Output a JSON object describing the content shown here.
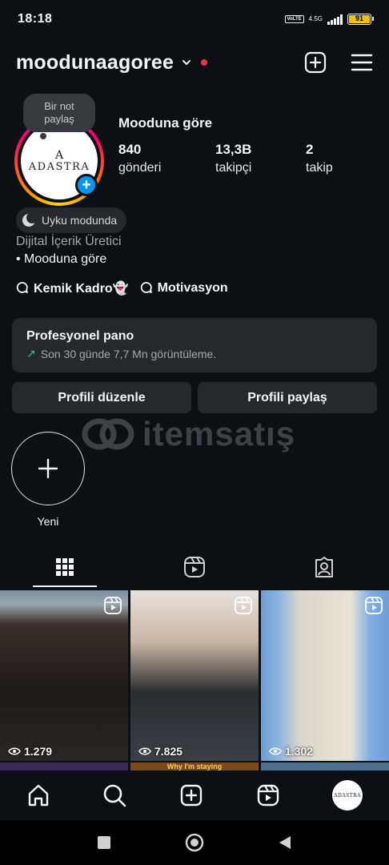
{
  "status_bar": {
    "time": "18:18",
    "volte": "VoLTE",
    "network": "4.5G",
    "battery": "91"
  },
  "header": {
    "username": "moodunaagoree"
  },
  "note": {
    "text": "Bir not paylaş"
  },
  "avatar": {
    "brand_letter": "A",
    "brand_name": "ADASTRA",
    "nav_brand": "ADASTRA"
  },
  "profile": {
    "display_name": "Mooduna göre",
    "stats": [
      {
        "value": "840",
        "label": "gönderi"
      },
      {
        "value": "13,3B",
        "label": "takipçi"
      },
      {
        "value": "2",
        "label": "takip"
      }
    ],
    "sleep_status": "Uyku modunda",
    "category": "Dijital İçerik Üretici",
    "bio": "• Mooduna göre",
    "channels": [
      "Kemik Kadro👻",
      "Motivasyon"
    ]
  },
  "pro_dashboard": {
    "title": "Profesyonel pano",
    "subtitle": "Son 30 günde 7,7 Mn görüntüleme."
  },
  "buttons": {
    "edit": "Profili düzenle",
    "share": "Profili paylaş"
  },
  "watermark": "itemsatış",
  "new_story": {
    "label": "Yeni"
  },
  "posts": [
    {
      "views": "1.279"
    },
    {
      "views": "7.825"
    },
    {
      "views": "1.302"
    }
  ],
  "row2_caption": "Why I'm staying",
  "colors": {
    "accent": "#0095f6",
    "background": "#0c1014",
    "card": "#25292e",
    "notification": "#ff3040",
    "trend": "#2ecc71"
  }
}
